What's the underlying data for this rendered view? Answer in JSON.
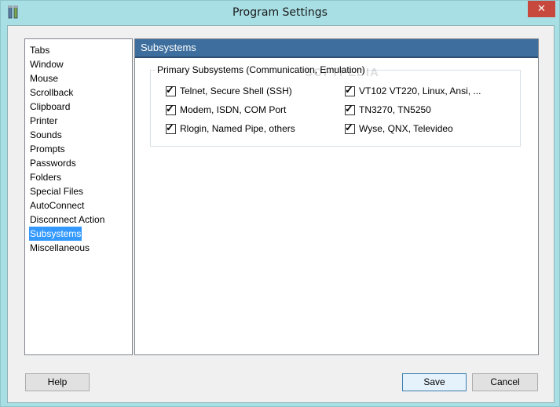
{
  "window": {
    "title": "Program Settings",
    "close_label": "✕"
  },
  "sidebar": {
    "items": [
      {
        "label": "Tabs"
      },
      {
        "label": "Window"
      },
      {
        "label": "Mouse"
      },
      {
        "label": "Scrollback"
      },
      {
        "label": "Clipboard"
      },
      {
        "label": "Printer"
      },
      {
        "label": "Sounds"
      },
      {
        "label": "Prompts"
      },
      {
        "label": "Passwords"
      },
      {
        "label": "Folders"
      },
      {
        "label": "Special Files"
      },
      {
        "label": "AutoConnect"
      },
      {
        "label": "Disconnect Action"
      },
      {
        "label": "Subsystems",
        "selected": true
      },
      {
        "label": "Miscellaneous"
      }
    ]
  },
  "panel": {
    "title": "Subsystems",
    "group": {
      "legend": "Primary Subsystems (Communication, Emulation)",
      "watermark": "SOFTPEDIA",
      "options": [
        {
          "label": "Telnet, Secure Shell (SSH)",
          "checked": true
        },
        {
          "label": "Modem, ISDN, COM Port",
          "checked": true
        },
        {
          "label": "Rlogin, Named Pipe, others",
          "checked": true
        },
        {
          "label": "VT102 VT220, Linux, Ansi, ...",
          "checked": true
        },
        {
          "label": "TN3270, TN5250",
          "checked": true
        },
        {
          "label": "Wyse, QNX, Televideo",
          "checked": true
        }
      ]
    }
  },
  "buttons": {
    "help": "Help",
    "save": "Save",
    "cancel": "Cancel"
  },
  "colors": {
    "selection": "#3399ff",
    "panel_header": "#3d6e9e",
    "close_button": "#c7483d"
  }
}
